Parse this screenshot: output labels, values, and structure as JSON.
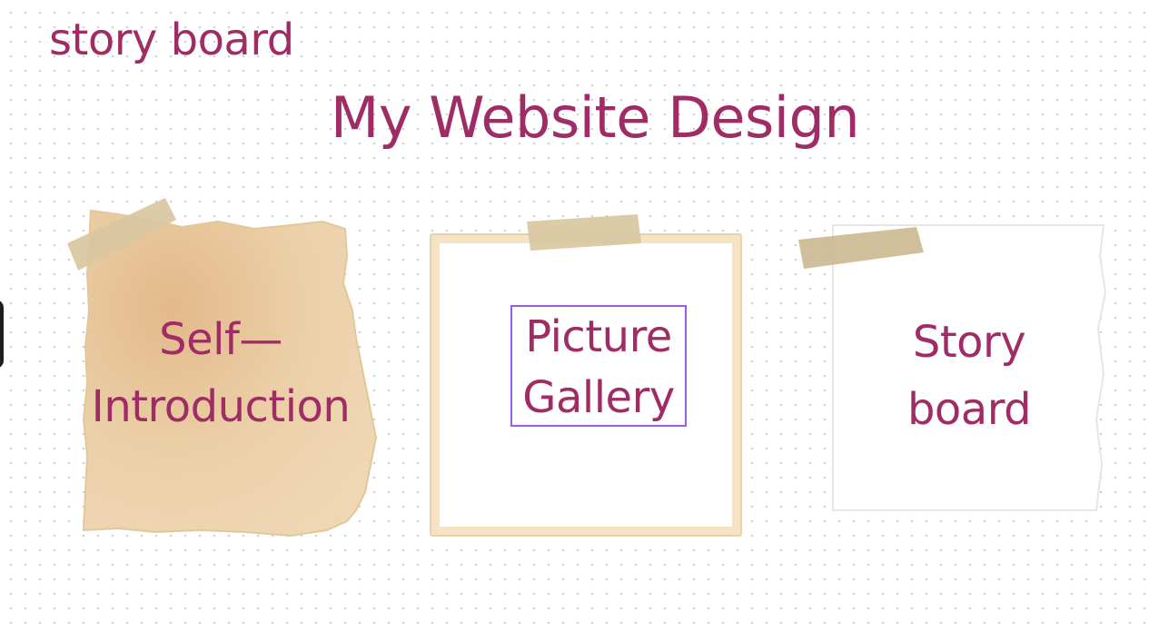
{
  "header": {
    "label": "story board",
    "title": "My Website Design"
  },
  "cards": [
    {
      "id": "self-introduction",
      "lines": [
        "Self—",
        "Introduction"
      ]
    },
    {
      "id": "picture-gallery",
      "lines": [
        "Picture",
        "Gallery"
      ]
    },
    {
      "id": "story-board",
      "lines": [
        "Story",
        "board"
      ]
    }
  ],
  "colors": {
    "accent_text": "#a02c66",
    "selection_outline": "#9b5de5",
    "kraft_paper": "#e9c99a",
    "tape": "#d8c7a0",
    "frame": "#f5e3c4"
  }
}
